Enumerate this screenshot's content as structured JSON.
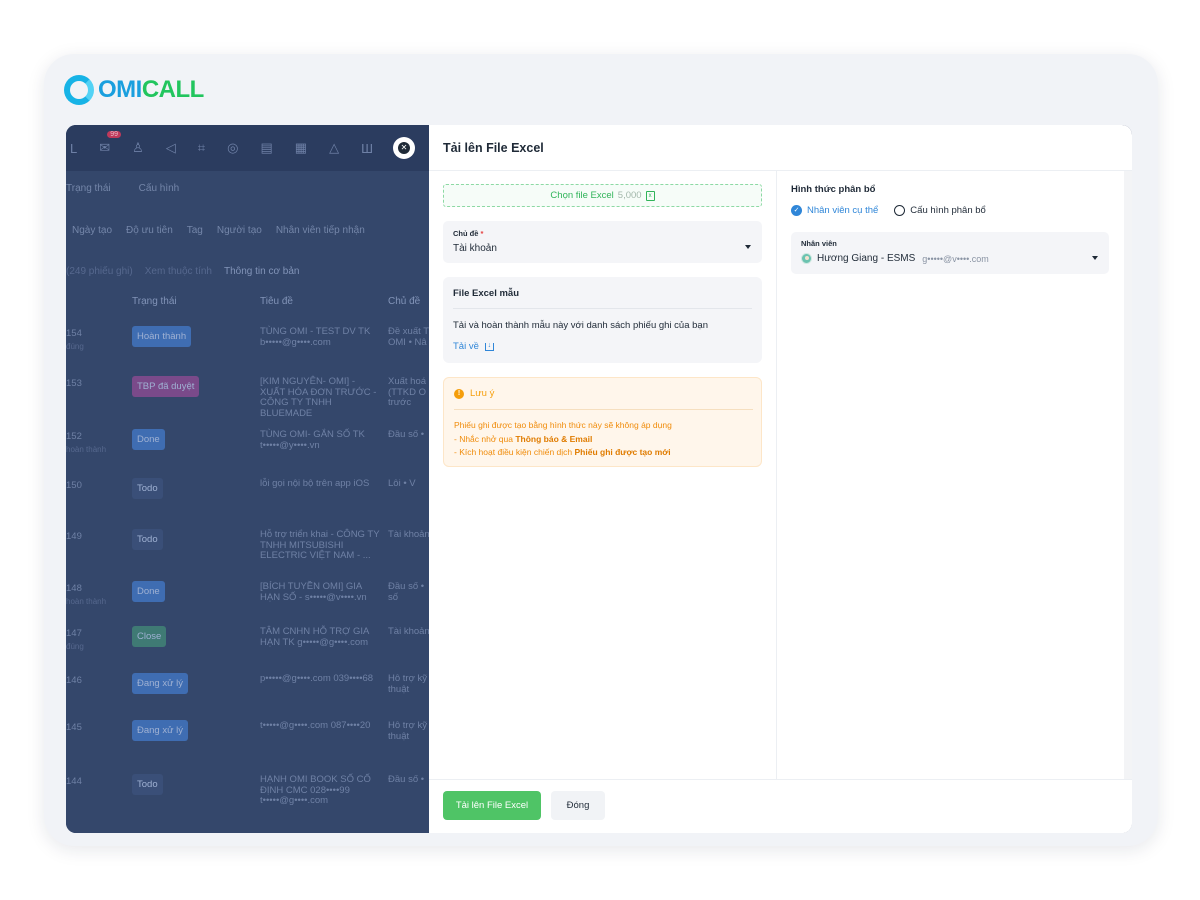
{
  "brand": {
    "logo_omi": "OMI",
    "logo_call": "CALL"
  },
  "background_app": {
    "badge_count": "99",
    "filter_row": [
      "Trạng thái",
      "Cấu hình"
    ],
    "filters": [
      "Ngày tạo",
      "Độ ưu tiên",
      "Tag",
      "Người tạo",
      "Nhân viên tiếp nhận"
    ],
    "view_row": [
      "(249 phiếu ghi)",
      "Xem thuộc tính",
      "Thông tin cơ bản"
    ],
    "columns": [
      "Trạng thái",
      "Tiêu đề",
      "Chủ đề"
    ],
    "rows": [
      {
        "id": "154",
        "sub": "đúng",
        "status": "Hoàn thành",
        "status_color": "#3f6db2",
        "title": "TÙNG OMI - TEST DV TK b•••••@g••••.com",
        "topic": "Đề xuất T OMI • Nâ"
      },
      {
        "id": "153",
        "sub": "",
        "status": "TBP đã duyệt",
        "status_color": "#7a4a8a",
        "title": "[KIM NGUYÊN- OMI] - XUẤT HÓA ĐƠN TRƯỚC - CÔNG TY TNHH BLUEMADE",
        "topic": "Xuất hoá (TTKD O trước"
      },
      {
        "id": "152",
        "sub": "hoàn thành",
        "status": "Done",
        "status_color": "#3f6db2",
        "title": "TÙNG OMI- GẮN SỐ TK t•••••@y••••.vn",
        "topic": "Đầu số •"
      },
      {
        "id": "150",
        "sub": "",
        "status": "Todo",
        "status_color": "#3a4f78",
        "title": "lỗi gọi nội bộ trên app iOS",
        "topic": "Lỗi • V"
      },
      {
        "id": "149",
        "sub": "",
        "status": "Todo",
        "status_color": "#3a4f78",
        "title": "Hỗ trợ triển khai - CÔNG TY TNHH MITSUBISHI ELECTRIC VIỆT NAM - ...",
        "topic": "Tài khoản"
      },
      {
        "id": "148",
        "sub": "hoàn thành",
        "status": "Done",
        "status_color": "#3f6db2",
        "title": "[BÍCH TUYỀN OMI] GIA HẠN SỐ - s•••••@v••••.vn",
        "topic": "Đầu số • số"
      },
      {
        "id": "147",
        "sub": "đúng",
        "status": "Close",
        "status_color": "#3f7a74",
        "title": "TÂM CNHN HỖ TRỢ GIA HẠN TK g•••••@g••••.com",
        "topic": "Tài khoản"
      },
      {
        "id": "146",
        "sub": "",
        "status": "Đang xử lý",
        "status_color": "#3f6db2",
        "title": "p•••••@g••••.com 039••••68",
        "topic": "Hỗ trợ kỹ thuật"
      },
      {
        "id": "145",
        "sub": "",
        "status": "Đang xử lý",
        "status_color": "#3f6db2",
        "title": "t•••••@g••••.com 087••••20",
        "topic": "Hỗ trợ kỹ thuật"
      },
      {
        "id": "144",
        "sub": "",
        "status": "Todo",
        "status_color": "#3a4f78",
        "title": "HẠNH OMI BOOK SỐ CỐ ĐỊNH CMC 028••••99 t•••••@g••••.com",
        "topic": "Đầu số •"
      }
    ]
  },
  "drawer": {
    "title": "Tải lên File Excel",
    "upload": {
      "label": "Chọn file Excel",
      "count": "5,000"
    },
    "topic_select": {
      "label": "Chủ đề",
      "required_mark": "*",
      "value": "Tài khoản"
    },
    "sample": {
      "title": "File Excel mẫu",
      "description": "Tải và hoàn thành mẫu này với danh sách phiếu ghi của bạn",
      "download_label": "Tải về"
    },
    "note": {
      "title": "Lưu ý",
      "line1": "Phiếu ghi được tạo bằng hình thức này sẽ không áp dụng",
      "line2_prefix": "- Nhắc nhở qua ",
      "line2_bold": "Thông báo & Email",
      "line3_prefix": "- Kích hoạt điều kiện chiến dịch ",
      "line3_bold": "Phiếu ghi được tạo mới"
    },
    "distribution": {
      "title": "Hình thức phân bổ",
      "options": [
        "Nhân viên cụ thể",
        "Cấu hình phân bổ"
      ],
      "selected_index": 0
    },
    "staff_select": {
      "label": "Nhân viên",
      "name": "Hương Giang - ESMS",
      "email": "g•••••@v••••.com"
    },
    "buttons": {
      "submit": "Tải lên File Excel",
      "close": "Đóng"
    }
  }
}
